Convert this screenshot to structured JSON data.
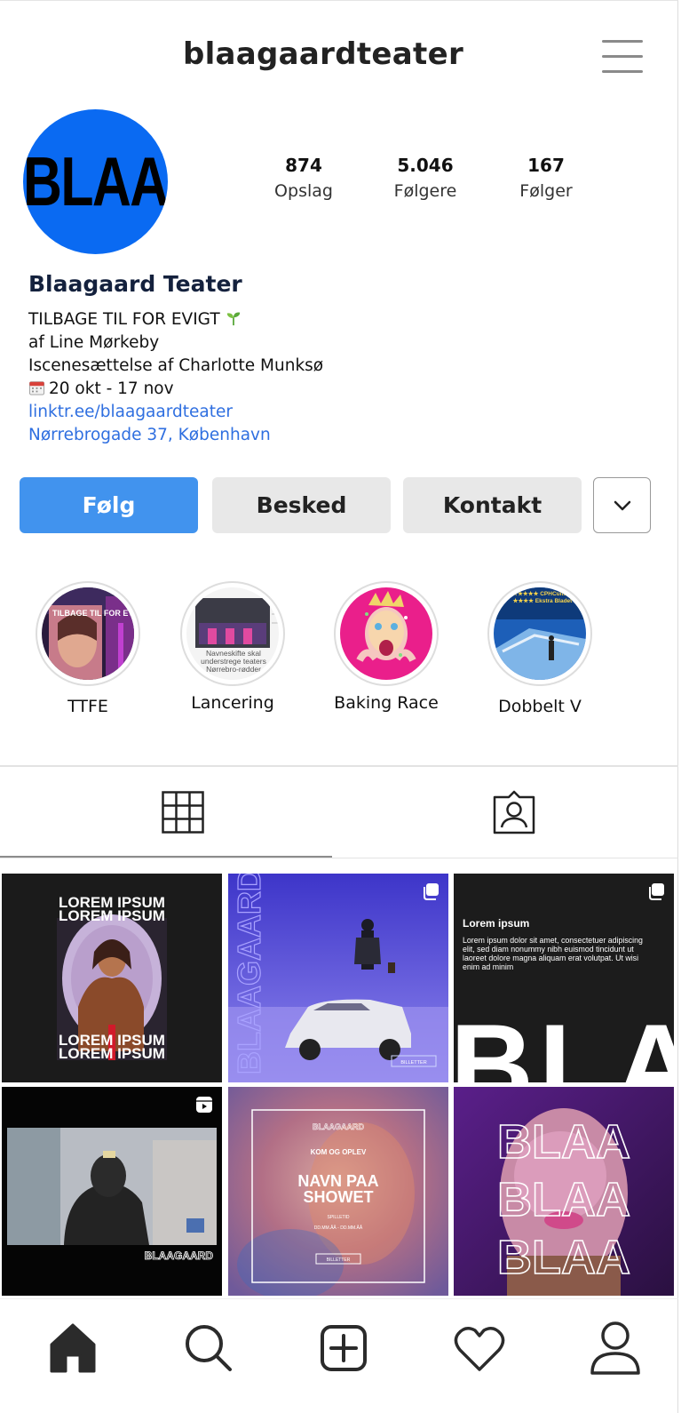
{
  "header": {
    "username": "blaagaardteater"
  },
  "profile": {
    "avatar_text": "BLAA",
    "name": "Blaagaard Teater",
    "bio_lines": [
      "TILBAGE TIL FOR EVIGT",
      "af Line Mørkeby",
      "Iscenesættelse af Charlotte Munksø",
      "20 okt - 17 nov"
    ],
    "link": "linktr.ee/blaagaardteater",
    "address": "Nørrebrogade 37, København"
  },
  "stats": [
    {
      "value": "874",
      "label": "Opslag"
    },
    {
      "value": "5.046",
      "label": "Følgere"
    },
    {
      "value": "167",
      "label": "Følger"
    }
  ],
  "actions": {
    "follow": "Følg",
    "message": "Besked",
    "contact": "Kontakt"
  },
  "highlights": [
    {
      "label": "TTFE",
      "img_text": "TILBAGE TIL FOR EVIGT"
    },
    {
      "label": "Lancering",
      "img_text": "Navneskifte skal understrege teaters Nørrebro-rødder"
    },
    {
      "label": "Baking Race",
      "img_text": ""
    },
    {
      "label": "Dobbelt V",
      "img_text": "★★★★★ CPHCulture ★★★★ Ekstra Bladet"
    }
  ],
  "posts": {
    "p1": {
      "top": "LOREM IPSUM",
      "bottom": "LOREM IPSUM"
    },
    "p2": {
      "side_text": "BLAAGAARD",
      "button": "BILLETTER"
    },
    "p3": {
      "title": "Lorem ipsum",
      "body": "Lorem ipsum dolor sit amet, consectetuer adipiscing elit, sed diam nonummy nibh euismod tincidunt ut laoreet dolore magna aliquam erat volutpat. Ut wisi enim ad minim",
      "big": "BLAA"
    },
    "p4": {
      "brand": "BLAAGAARD"
    },
    "p5": {
      "brand": "BLAAGAARD",
      "sub": "KOM OG OPLEV",
      "title1": "NAVN PAA",
      "title2": "SHOWET",
      "small1": "SPILLETID",
      "small2": "DD.MM.ÅÅ - DD.MM.ÅÅ",
      "button": "BILLETTER"
    },
    "p6": {
      "word": "BLAA"
    }
  },
  "colors": {
    "accent": "#4193ee",
    "brand_blue": "#0a6af2",
    "link": "#2f6fe0"
  }
}
